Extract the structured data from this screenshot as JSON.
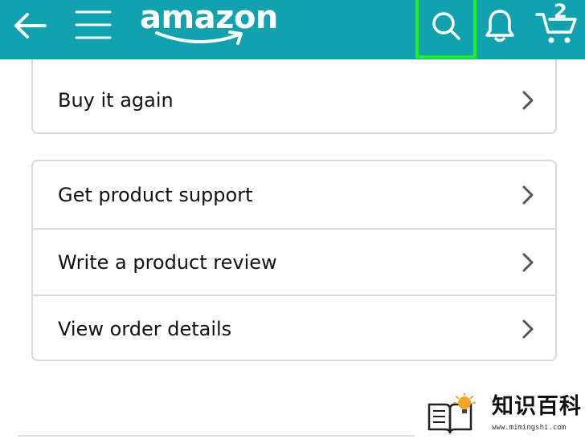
{
  "topbar": {
    "background": "#11a2b0",
    "back_icon": "back-arrow-icon",
    "menu_icon": "hamburger-menu-icon",
    "logo_text": "amazon",
    "search_icon": "search-icon",
    "search_highlight_color": "#1ef21e",
    "notification_icon": "bell-icon",
    "cart_icon": "cart-icon",
    "cart_count": "2"
  },
  "sections": {
    "first": {
      "items": [
        {
          "label": "Buy it again",
          "icon": "chevron-right-icon"
        }
      ]
    },
    "second": {
      "items": [
        {
          "label": "Get product support",
          "icon": "chevron-right-icon"
        },
        {
          "label": "Write a product review",
          "icon": "chevron-right-icon"
        },
        {
          "label": "View order details",
          "icon": "chevron-right-icon"
        }
      ]
    }
  },
  "watermark": {
    "icon": "book-lightbulb-icon",
    "text": "知识百科",
    "url": "www.mimingshi.com"
  }
}
